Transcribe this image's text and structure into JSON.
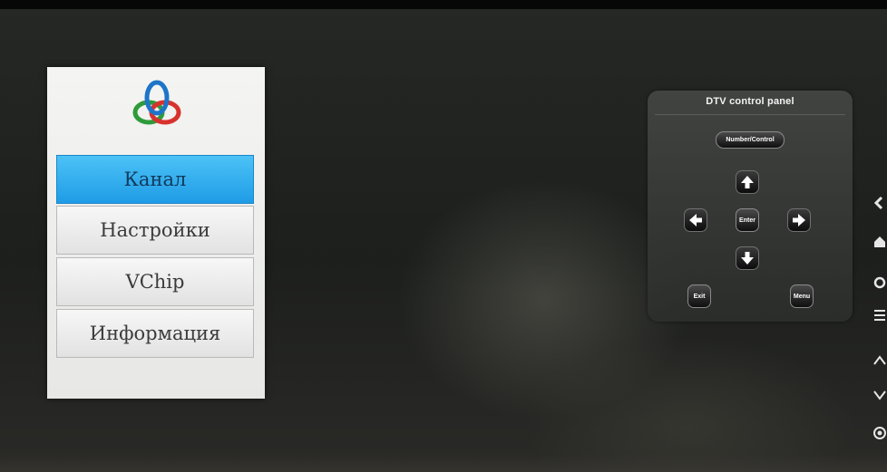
{
  "menu": {
    "items": [
      {
        "label": "Канал",
        "selected": true
      },
      {
        "label": "Настройки",
        "selected": false
      },
      {
        "label": "VChip",
        "selected": false
      },
      {
        "label": "Информация",
        "selected": false
      }
    ],
    "logo_icon": "tri-ring-logo"
  },
  "dtv_panel": {
    "title": "DTV control panel",
    "number_control_label": "Number/Control",
    "enter_label": "Enter",
    "exit_label": "Exit",
    "menu_label": "Menu",
    "arrows": [
      "up-arrow-icon",
      "left-arrow-icon",
      "right-arrow-icon",
      "down-arrow-icon"
    ]
  },
  "colors": {
    "selected_item": "#1f9ce6",
    "menu_background": "#eeeeec",
    "panel_background": "#464846"
  }
}
